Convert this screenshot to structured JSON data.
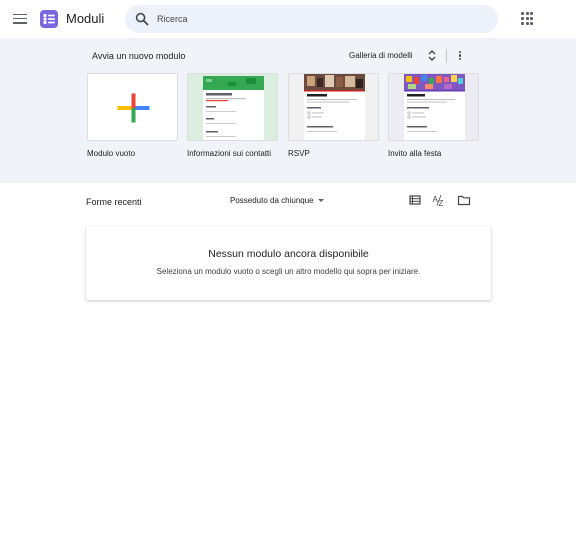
{
  "header": {
    "app_title": "Moduli",
    "search_placeholder": "Ricerca"
  },
  "gallery": {
    "title": "Avvia un nuovo modulo",
    "gallery_link": "Galleria di modelli",
    "templates": [
      {
        "label": "Modulo vuoto"
      },
      {
        "label": "Informazioni sui contatti"
      },
      {
        "label": "RSVP"
      },
      {
        "label": "Invito alla festa"
      }
    ]
  },
  "recent": {
    "title": "Forme recenti",
    "owner_filter": "Posseduto da chiunque",
    "empty_title": "Nessun modulo ancora disponibile",
    "empty_subtitle": "Seleziona un modulo vuoto o scegli un altro modello qui sopra per iniziare."
  },
  "colors": {
    "accent": "#673ab7",
    "gallery_bg": "#f0f4f9",
    "search_bg": "#edf2fa",
    "contact_template_green": "#34a853"
  }
}
